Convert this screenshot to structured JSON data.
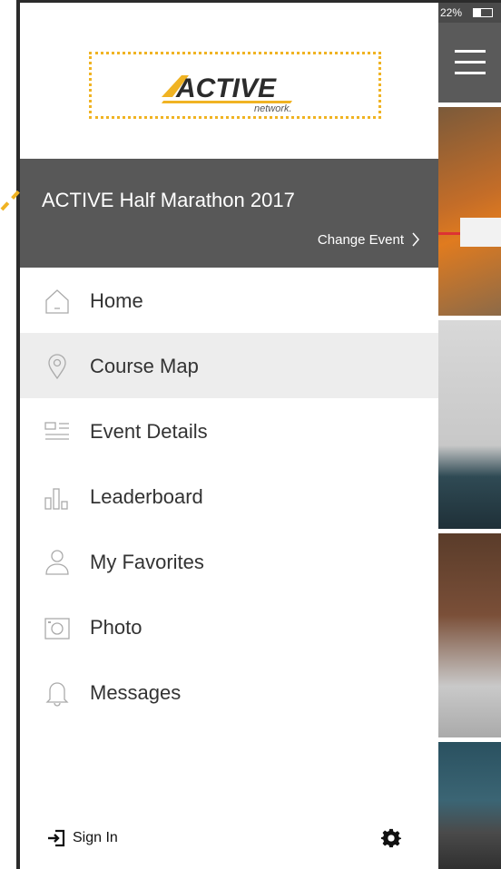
{
  "status": {
    "battery": "22%"
  },
  "logo": {
    "brand": "ACTIVE",
    "sub": "network."
  },
  "event": {
    "title": "ACTIVE Half Marathon 2017",
    "change": "Change Event"
  },
  "menu": [
    {
      "label": "Home",
      "icon": "home-icon",
      "active": false
    },
    {
      "label": "Course Map",
      "icon": "map-pin-icon",
      "active": true
    },
    {
      "label": "Event Details",
      "icon": "details-icon",
      "active": false
    },
    {
      "label": "Leaderboard",
      "icon": "leaderboard-icon",
      "active": false
    },
    {
      "label": "My Favorites",
      "icon": "person-icon",
      "active": false
    },
    {
      "label": "Photo",
      "icon": "camera-icon",
      "active": false
    },
    {
      "label": "Messages",
      "icon": "bell-icon",
      "active": false
    }
  ],
  "footer": {
    "signin": "Sign In"
  },
  "colors": {
    "accent": "#f0b323",
    "event_bar": "#585858",
    "active_row": "#ededed"
  }
}
